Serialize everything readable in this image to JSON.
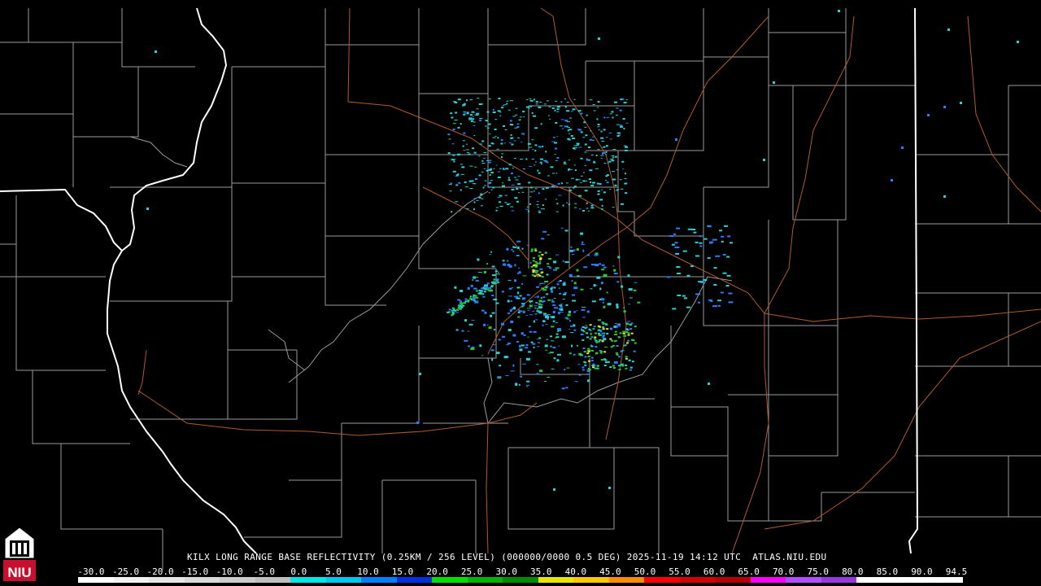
{
  "product": {
    "title": "KILX LONG RANGE BASE REFLECTIVITY (0.25KM / 256 LEVEL) (000000/0000 0.5 DEG) 2025-11-19 14:12 UTC  ATLAS.NIU.EDU"
  },
  "logo": {
    "text": "NIU",
    "color": "#c8102e"
  },
  "colors": {
    "county_border": "#9a9a9a",
    "state_border": "#ffffff",
    "highway": "#b05a2a",
    "echo_light": "#2ad1d1",
    "echo_mid": "#2a7dff",
    "echo_green": "#28c828",
    "echo_yellow": "#f0e020"
  },
  "legend": {
    "ticks": [
      "-30.0",
      "-25.0",
      "-20.0",
      "-15.0",
      "-10.0",
      "-5.0",
      "0.0",
      "5.0",
      "10.0",
      "15.0",
      "20.0",
      "25.0",
      "30.0",
      "35.0",
      "40.0",
      "45.0",
      "50.0",
      "55.0",
      "60.0",
      "65.0",
      "70.0",
      "75.0",
      "80.0",
      "85.0",
      "90.0",
      "94.5"
    ],
    "colors": [
      "#ffffff",
      "#f2f2f2",
      "#e6e6e6",
      "#d9d9d9",
      "#cccccc",
      "#bfbfbf",
      "#00e6e6",
      "#00c8f0",
      "#0080ff",
      "#0030e0",
      "#00e000",
      "#00b400",
      "#008c00",
      "#e6e600",
      "#ffc800",
      "#ff8c00",
      "#ff0000",
      "#d20000",
      "#b40000",
      "#ff00ff",
      "#b44cff",
      "#9a38e0",
      "#ffffff",
      "#ffffff",
      "#ffffff"
    ]
  }
}
